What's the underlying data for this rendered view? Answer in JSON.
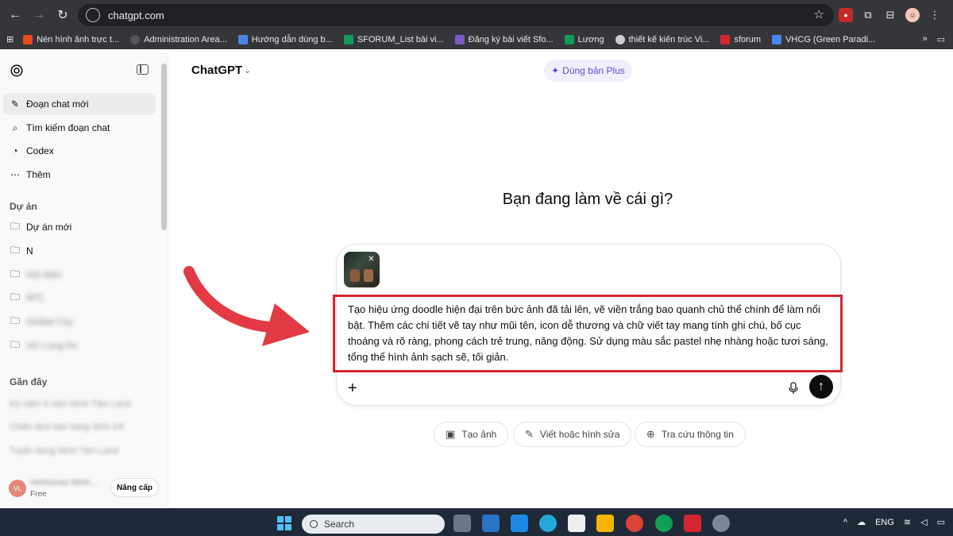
{
  "browser": {
    "url": "chatgpt.com",
    "bookmarks": [
      {
        "label": "Nén hình ảnh trực t...",
        "color": "#e8491d"
      },
      {
        "label": "Administration Area...",
        "color": "#222222"
      },
      {
        "label": "Hướng dẫn dùng b...",
        "color": "#4a86e8"
      },
      {
        "label": "SFORUM_List bài vi...",
        "color": "#0f9d58"
      },
      {
        "label": "Đăng ký bài viết Sfo...",
        "color": "#7e57c2"
      },
      {
        "label": "Lương",
        "color": "#0f9d58"
      },
      {
        "label": "thiết kế kiến trúc Vi...",
        "color": "#cccccc"
      },
      {
        "label": "sforum",
        "color": "#d32630"
      },
      {
        "label": "VHCG (Green Paradi...",
        "color": "#4a86e8"
      }
    ],
    "bookmarks_more": "»",
    "all_bookmarks": "▭"
  },
  "sidebar": {
    "nav": [
      {
        "label": "Đoạn chat mới",
        "icon": "✎"
      },
      {
        "label": "Tìm kiếm đoạn chat",
        "icon": "⌕"
      },
      {
        "label": "Codex",
        "icon": "◔"
      },
      {
        "label": "Thêm",
        "icon": "⋯"
      }
    ],
    "projects_title": "Dự án",
    "projects": [
      {
        "label": "Dự án mới",
        "icon": "🗀"
      },
      {
        "label": "N",
        "icon": "🗀"
      },
      {
        "label": "Hội Mến",
        "icon": "🗀"
      },
      {
        "label": "MTL",
        "icon": "🗀"
      },
      {
        "label": "Global City",
        "icon": "🗀"
      },
      {
        "label": "Vin Long An",
        "icon": "🗀"
      }
    ],
    "recent_title": "Gần đây",
    "recent": [
      "Kỷ niệm 5 năm Minh Tâm Land",
      "Chiến dịch bán hàng 30/4-1/5",
      "Tuyển dụng Minh Tâm Land"
    ],
    "user": {
      "initials": "VL",
      "name": "Vinhomes Minh...",
      "plan": "Free",
      "upgrade": "Nâng cấp"
    }
  },
  "main": {
    "model": "ChatGPT",
    "plus_button": "Dùng bản Plus",
    "headline": "Bạn đang làm về cái gì?",
    "prompt": "Tạo hiệu ứng doodle hiện đại trên bức ảnh đã tải lên, vẽ viền trắng bao quanh chủ thể chính để làm nổi bật. Thêm các chi tiết vẽ tay như mũi tên, icon dễ thương và chữ viết tay mang tính ghi chú, bố cục thoáng và rõ ràng, phong cách trẻ trung, năng động. Sử dụng màu sắc pastel nhẹ nhàng hoặc tươi sáng, tổng thể hình ảnh sạch sẽ, tối giản.",
    "chips": [
      {
        "label": "Tạo ảnh",
        "icon": "▣"
      },
      {
        "label": "Viết hoặc hình sửa",
        "icon": "✎"
      },
      {
        "label": "Tra cứu thông tin",
        "icon": "⊕"
      }
    ],
    "highlight_color": "#d32630"
  },
  "taskbar": {
    "search": "Search",
    "lang": "ENG"
  }
}
